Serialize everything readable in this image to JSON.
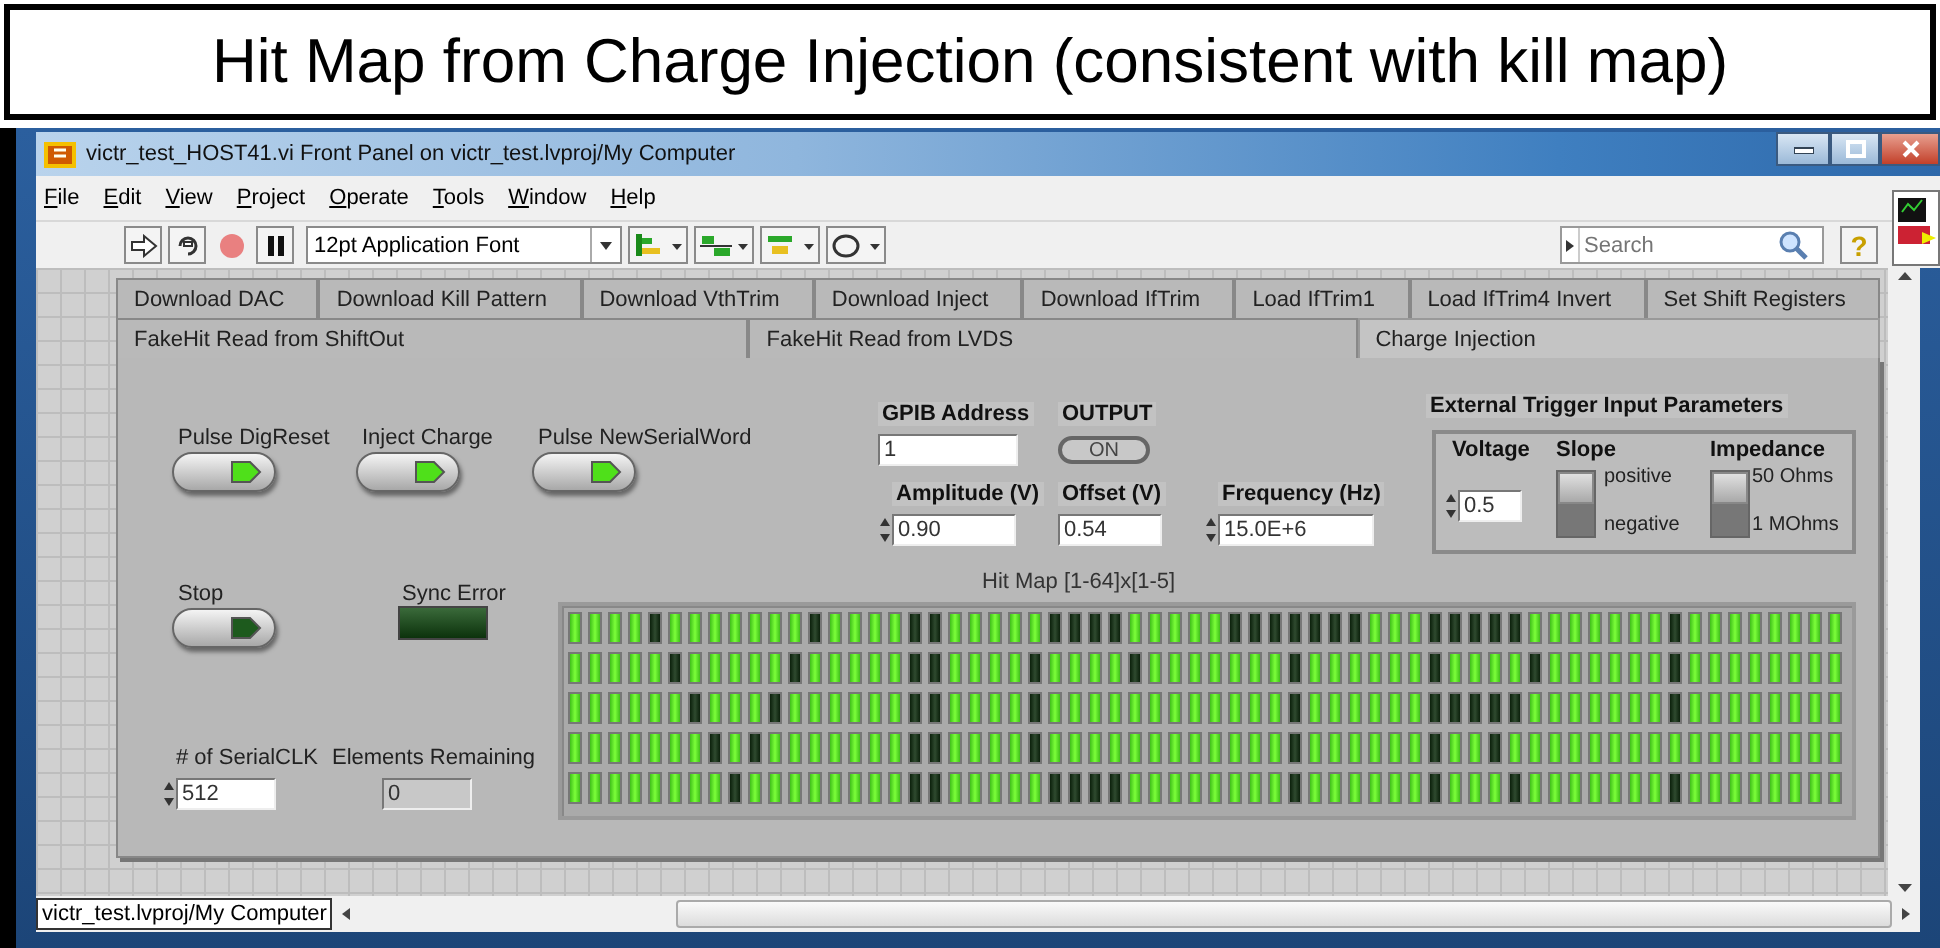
{
  "slide_title": "Hit Map from Charge Injection (consistent with kill map)",
  "window": {
    "title": "victr_test_HOST41.vi Front Panel on victr_test.lvproj/My Computer"
  },
  "menu": [
    "File",
    "Edit",
    "View",
    "Project",
    "Operate",
    "Tools",
    "Window",
    "Help"
  ],
  "toolbar": {
    "font": "12pt Application Font",
    "search": {
      "placeholder": "Search"
    },
    "help": "?"
  },
  "tab_rows": [
    [
      {
        "label": "Download DAC",
        "selected": false
      },
      {
        "label": "Download Kill Pattern",
        "selected": false
      },
      {
        "label": "Download VthTrim",
        "selected": false
      },
      {
        "label": "Download Inject",
        "selected": false
      },
      {
        "label": "Download IfTrim",
        "selected": false
      },
      {
        "label": "Load IfTrim1",
        "selected": false
      },
      {
        "label": "Load IfTrim4 Invert",
        "selected": false
      },
      {
        "label": "Set Shift Registers",
        "selected": false
      }
    ],
    [
      {
        "label": "FakeHit Read from ShiftOut",
        "selected": false
      },
      {
        "label": "FakeHit Read from LVDS",
        "selected": false
      },
      {
        "label": "Charge Injection",
        "selected": true
      }
    ]
  ],
  "panel": {
    "pulse_buttons": [
      {
        "label": "Pulse DigReset",
        "on": true
      },
      {
        "label": "Inject Charge",
        "on": true
      },
      {
        "label": "Pulse NewSerialWord",
        "on": true
      }
    ],
    "stop": {
      "label": "Stop",
      "on": false
    },
    "sync_error": {
      "label": "Sync Error",
      "on": false
    },
    "serial_clk": {
      "label": "# of SerialCLK",
      "value": "512"
    },
    "elements_remaining": {
      "label": "Elements Remaining",
      "value": "0"
    },
    "gpib_address": {
      "label": "GPIB Address",
      "value": "1"
    },
    "output": {
      "label": "OUTPUT",
      "text": "ON"
    },
    "amplitude": {
      "label": "Amplitude (V)",
      "value": "0.90"
    },
    "offset": {
      "label": "Offset (V)",
      "value": "0.54"
    },
    "frequency": {
      "label": "Frequency (Hz)",
      "value": "15.0E+6"
    },
    "trigger": {
      "title": "External Trigger Input Parameters",
      "voltage": {
        "label": "Voltage",
        "value": "0.5"
      },
      "slope": {
        "label": "Slope",
        "options": [
          {
            "label": "positive",
            "selected": true
          },
          {
            "label": "negative",
            "selected": false
          }
        ]
      },
      "impedance": {
        "label": "Impedance",
        "options": [
          {
            "label": "50 Ohms",
            "selected": true
          },
          {
            "label": "1 MOhms",
            "selected": false
          }
        ]
      }
    },
    "hit_map": {
      "label": "Hit Map [1-64]x[1-5]",
      "rows": [
        [
          true,
          true,
          true,
          true,
          false,
          true,
          true,
          true,
          true,
          true,
          true,
          true,
          false,
          true,
          true,
          true,
          true,
          false,
          false,
          true,
          true,
          true,
          true,
          true,
          false,
          false,
          false,
          false,
          true,
          true,
          true,
          true,
          true,
          false,
          false,
          false,
          false,
          false,
          false,
          false,
          true,
          true,
          true,
          false,
          false,
          false,
          false,
          false,
          true,
          true,
          true,
          true,
          true,
          true,
          true,
          false,
          true,
          true,
          true,
          true,
          true,
          true,
          true,
          true
        ],
        [
          true,
          true,
          true,
          true,
          true,
          false,
          true,
          true,
          true,
          true,
          true,
          false,
          true,
          true,
          true,
          true,
          true,
          false,
          false,
          true,
          true,
          true,
          true,
          false,
          true,
          true,
          true,
          true,
          false,
          true,
          true,
          true,
          true,
          true,
          true,
          true,
          false,
          true,
          true,
          true,
          true,
          true,
          true,
          false,
          true,
          true,
          true,
          true,
          false,
          true,
          true,
          true,
          true,
          true,
          true,
          false,
          true,
          true,
          true,
          true,
          true,
          true,
          true,
          true
        ],
        [
          true,
          true,
          true,
          true,
          true,
          true,
          false,
          true,
          true,
          true,
          false,
          true,
          true,
          true,
          true,
          true,
          true,
          false,
          false,
          true,
          true,
          true,
          true,
          false,
          true,
          true,
          true,
          true,
          true,
          true,
          true,
          true,
          true,
          true,
          true,
          true,
          false,
          true,
          true,
          true,
          true,
          true,
          true,
          false,
          false,
          false,
          false,
          false,
          true,
          true,
          true,
          true,
          true,
          true,
          true,
          false,
          true,
          true,
          true,
          true,
          true,
          true,
          true,
          true
        ],
        [
          true,
          true,
          true,
          true,
          true,
          true,
          true,
          false,
          true,
          false,
          true,
          true,
          true,
          true,
          true,
          true,
          true,
          false,
          false,
          true,
          true,
          true,
          true,
          false,
          true,
          true,
          true,
          true,
          true,
          true,
          true,
          true,
          true,
          true,
          true,
          true,
          false,
          true,
          true,
          true,
          true,
          true,
          true,
          false,
          true,
          true,
          false,
          true,
          true,
          true,
          true,
          true,
          true,
          true,
          true,
          true,
          true,
          true,
          true,
          true,
          true,
          true,
          true,
          true
        ],
        [
          true,
          true,
          true,
          true,
          true,
          true,
          true,
          true,
          false,
          true,
          true,
          true,
          true,
          true,
          true,
          true,
          true,
          false,
          false,
          true,
          true,
          true,
          true,
          true,
          false,
          false,
          false,
          false,
          true,
          true,
          true,
          true,
          true,
          true,
          true,
          true,
          false,
          true,
          true,
          true,
          true,
          true,
          true,
          false,
          true,
          true,
          true,
          false,
          true,
          true,
          true,
          true,
          true,
          true,
          true,
          false,
          true,
          true,
          true,
          true,
          true,
          true,
          true,
          true
        ]
      ]
    }
  },
  "status_bar": {
    "path": "victr_test.lvproj/My Computer"
  }
}
